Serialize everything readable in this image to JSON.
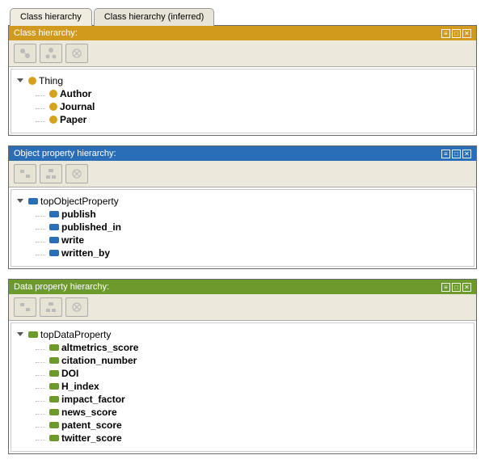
{
  "tabs": {
    "active": "Class hierarchy",
    "inactive": "Class hierarchy (inferred)"
  },
  "class_panel": {
    "title": "Class hierarchy:",
    "root": "Thing",
    "children": [
      "Author",
      "Journal",
      "Paper"
    ]
  },
  "object_panel": {
    "title": "Object property hierarchy:",
    "root": "topObjectProperty",
    "children": [
      "publish",
      "published_in",
      "write",
      "written_by"
    ]
  },
  "data_panel": {
    "title": "Data property hierarchy:",
    "root": "topDataProperty",
    "children": [
      "altmetrics_score",
      "citation_number",
      "DOI",
      "H_index",
      "impact_factor",
      "news_score",
      "patent_score",
      "twitter_score"
    ]
  }
}
